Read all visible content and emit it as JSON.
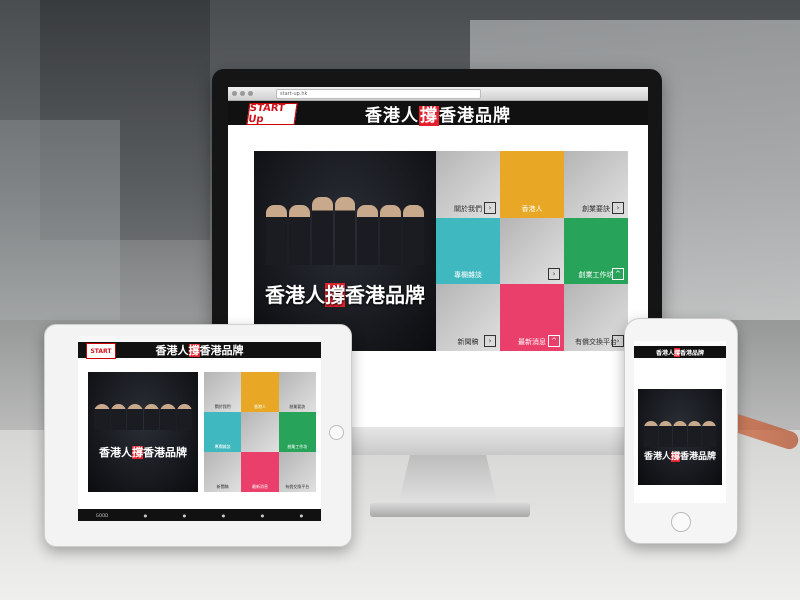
{
  "desktop": {
    "browser_url": "start-up.hk",
    "header_title_a": "香港人",
    "header_title_hl": "撐",
    "header_title_b": "香港品牌",
    "logo_text": "START Up",
    "hero_title_a": "香港人",
    "hero_title_hl": "撐",
    "hero_title_b": "香港品牌",
    "tiles": [
      {
        "label": "關於我們",
        "style": "photo"
      },
      {
        "label": "香港人",
        "style": "yellow"
      },
      {
        "label": "創業要訣",
        "style": "photo"
      },
      {
        "label": "專欄雜談",
        "style": "teal"
      },
      {
        "label": "",
        "style": "photo"
      },
      {
        "label": "創業工作坊",
        "style": "green"
      },
      {
        "label": "新聞稿",
        "style": "photo"
      },
      {
        "label": "最新消息",
        "style": "pink"
      },
      {
        "label": "有償交換平台",
        "style": "photo"
      }
    ]
  },
  "tablet": {
    "header_title_a": "香港人",
    "header_title_hl": "撐",
    "header_title_b": "香港品牌",
    "hero_title_a": "香港人",
    "hero_title_hl": "撐",
    "hero_title_b": "香港品牌",
    "footer_logos": [
      "GOOD",
      "",
      "",
      "",
      "",
      ""
    ]
  },
  "phone": {
    "header_title_a": "香港人",
    "header_title_hl": "撐",
    "header_title_b": "香港品牌",
    "hero_title_a": "香港人",
    "hero_title_hl": "撐",
    "hero_title_b": "香港品牌"
  },
  "colors": {
    "accent_red": "#e3202b",
    "yellow": "#e8a825",
    "green": "#27a45a",
    "teal": "#3fb8c0",
    "pink": "#ea3f6a"
  }
}
